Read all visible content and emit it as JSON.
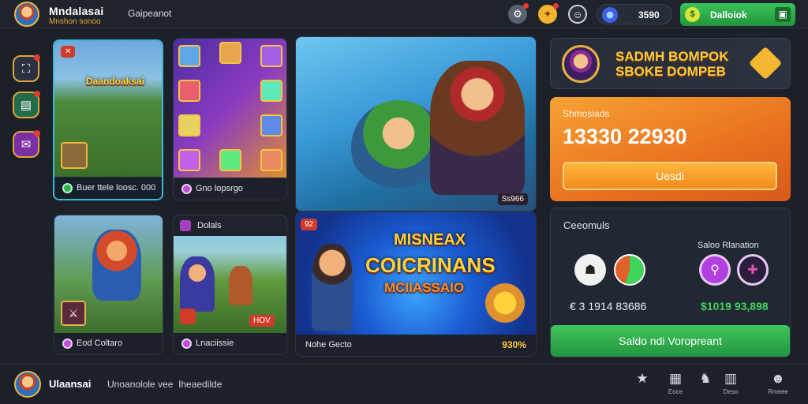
{
  "header": {
    "app_title": "Mndalasai",
    "app_subtitle": "Mnshon sonoo",
    "section_label": "Gaipeanot",
    "balance": "3590",
    "action_button": "Dalloiok"
  },
  "sidebar": {
    "items": [
      {
        "icon": "map-icon"
      },
      {
        "icon": "card-icon"
      },
      {
        "icon": "gift-icon"
      }
    ]
  },
  "games": [
    {
      "overlay_title": "Daandoaksai",
      "caption": "Buer ttele loosc. 000"
    },
    {
      "caption": "Gno lopsrgo"
    },
    {
      "badge": "Ss966"
    },
    {
      "caption": "Eod Coltaro"
    },
    {
      "label": "Dolals",
      "badge": "HOV",
      "caption": "Lnaciissie"
    },
    {
      "promo_lines": [
        "MISNEAX",
        "COICRINANS",
        "MCIIASSAIO"
      ],
      "corner_badge": "92",
      "caption": "Nohe Gecto",
      "percent": "930%"
    }
  ],
  "jackpot_banner": {
    "line1": "SADMH BOMPOK",
    "line2": "SBOKE DOMPEB"
  },
  "jackpot_panel": {
    "label": "Shmosiads",
    "value": "13330 22930",
    "button": "Uesdi"
  },
  "wallet": {
    "title": "Ceeomuls",
    "sub_label": "Saloo Rlanation",
    "amount_left": "€ 3 1914 83686",
    "amount_right": "$1019 93,898",
    "button": "Saldo ndi Voropreant"
  },
  "footer": {
    "user_name": "Ulaansai",
    "link1": "Unoanolole vee",
    "link2": "Iheaedilde",
    "nav": [
      {
        "icon": "star-icon",
        "label": ""
      },
      {
        "icon": "shop-icon",
        "label": "Eoce"
      },
      {
        "icon": "trophy-icon",
        "label": ""
      },
      {
        "icon": "bag-icon",
        "label": "Deso"
      },
      {
        "icon": "profile-icon",
        "label": "Rmeee"
      }
    ]
  },
  "colors": {
    "background": "#1b2029",
    "accent_orange": "#f08a1e",
    "accent_green": "#2fb24d",
    "accent_gold": "#ffc93c",
    "selected_border": "#3fb7d8"
  }
}
